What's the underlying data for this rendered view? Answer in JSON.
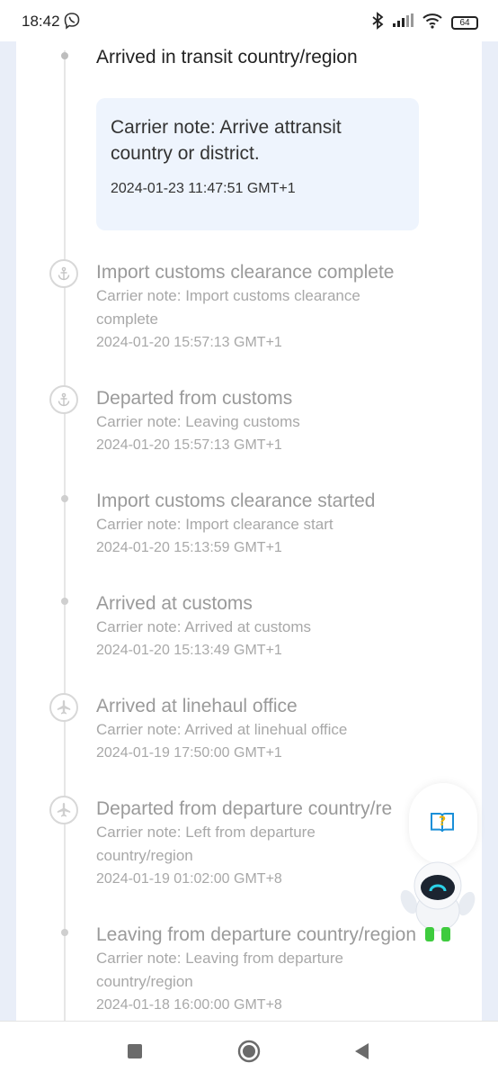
{
  "status_bar": {
    "time": "18:42",
    "battery": "64"
  },
  "current_event": {
    "title": "Arrived in transit country/region",
    "note_lines": [
      "Carrier note: Arrive attransit",
      "country or district."
    ],
    "time": "2024-01-23 11:47:51 GMT+1"
  },
  "events": [
    {
      "title": "Import customs clearance complete",
      "note_lines": [
        "Carrier note: Import customs clearance",
        "complete"
      ],
      "time": "2024-01-20 15:57:13 GMT+1",
      "icon": "anchor-icon"
    },
    {
      "title": "Departed from customs",
      "note_lines": [
        "Carrier note: Leaving customs"
      ],
      "time": "2024-01-20 15:57:13 GMT+1",
      "icon": "anchor-icon"
    },
    {
      "title": "Import customs clearance started",
      "note_lines": [
        "Carrier note: Import clearance start"
      ],
      "time": "2024-01-20 15:13:59 GMT+1",
      "icon": "dot"
    },
    {
      "title": "Arrived at customs",
      "note_lines": [
        "Carrier note: Arrived at customs"
      ],
      "time": "2024-01-20 15:13:49 GMT+1",
      "icon": "dot"
    },
    {
      "title": "Arrived at linehaul office",
      "note_lines": [
        "Carrier note: Arrived at linehual office"
      ],
      "time": "2024-01-19 17:50:00 GMT+1",
      "icon": "airplane-icon"
    },
    {
      "title": "Departed from departure country/re",
      "note_lines": [
        "Carrier note: Left from departure",
        "country/region"
      ],
      "time": "2024-01-19 01:02:00 GMT+8",
      "icon": "airplane-icon"
    },
    {
      "title": "Leaving from departure country/region",
      "note_lines": [
        "Carrier note: Leaving from departure",
        "country/region"
      ],
      "time": "2024-01-18 16:00:00 GMT+8",
      "icon": "dot"
    }
  ],
  "help_widget": {
    "icon": "question-book-icon",
    "mascot": "robot-mascot"
  },
  "colors": {
    "accent": "#1a8fd8",
    "highlight_bg": "#eef4fd",
    "muted_text": "#9a9a9a"
  }
}
